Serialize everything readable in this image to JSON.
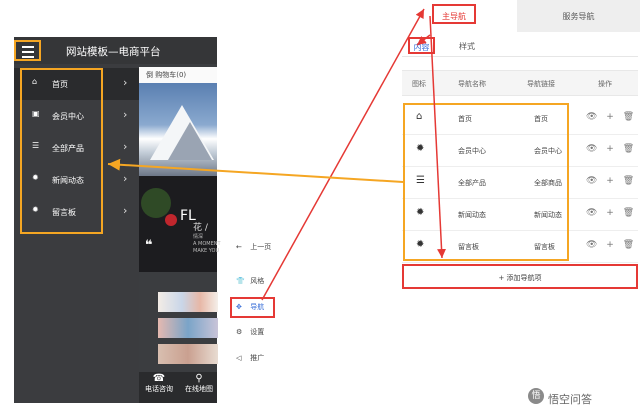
{
  "phone": {
    "title": "网站模板—电商平台",
    "cart_text": "倒 购物车(0)",
    "nav_items": [
      {
        "label": "首页",
        "icon": "home-icon",
        "glyph": "⌂"
      },
      {
        "label": "会员中心",
        "icon": "member-icon",
        "glyph": "▣"
      },
      {
        "label": "全部产品",
        "icon": "products-icon",
        "glyph": "☰"
      },
      {
        "label": "新闻动态",
        "icon": "news-icon",
        "glyph": "✹"
      },
      {
        "label": "留言板",
        "icon": "message-board-icon",
        "glyph": "✹"
      }
    ],
    "chevron": "›",
    "banner_text": "FL",
    "banner_sub": "花 /",
    "banner_copy": [
      "情深",
      "A MOMENT",
      "MAKE YOU"
    ],
    "quote_mark": "❝",
    "footer": [
      {
        "label": "电话咨询",
        "glyph": "☎"
      },
      {
        "label": "在线地图",
        "glyph": "⚲"
      }
    ]
  },
  "toolbar": {
    "items": [
      {
        "label": "上一页",
        "glyph": "←"
      },
      {
        "label": "风格",
        "glyph": "👕"
      },
      {
        "label": "导航",
        "glyph": "✥"
      },
      {
        "label": "设置",
        "glyph": "⚙"
      },
      {
        "label": "推广",
        "glyph": "◁"
      }
    ]
  },
  "panel": {
    "tab_main": "主导航",
    "tab_service": "服务导航",
    "subtab_content": "内容",
    "subtab_style": "样式",
    "columns": [
      "图标",
      "导航名称",
      "导航链接",
      "操作"
    ],
    "rows": [
      {
        "name": "首页",
        "link": "首页",
        "glyph": "⌂"
      },
      {
        "name": "会员中心",
        "link": "会员中心",
        "glyph": "✹"
      },
      {
        "name": "全部产品",
        "link": "全部商品",
        "glyph": "☰"
      },
      {
        "name": "新闻动态",
        "link": "新闻动态",
        "glyph": "✹"
      },
      {
        "name": "留言板",
        "link": "留言板",
        "glyph": "✹"
      }
    ],
    "row_ops": "👁 + 🗑",
    "add_button": "+ 添加导航项"
  },
  "watermark": {
    "text": "悟空问答",
    "logo": "悟"
  },
  "colors": {
    "annotation_orange": "#f5a623",
    "annotation_red": "#e53935",
    "link_blue": "#3a6fd8",
    "phone_dark": "#3b3d40"
  }
}
